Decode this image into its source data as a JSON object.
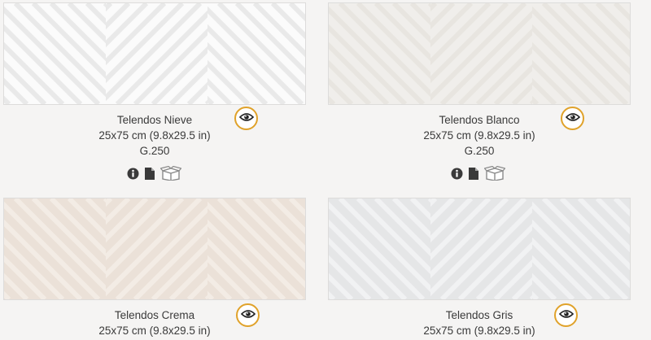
{
  "products": [
    {
      "name": "Telendos Nieve",
      "size": "25x75 cm (9.8x29.5 in)",
      "grade": "G.250",
      "tile_color": "#fbfbfb",
      "stripe_color": "#e9e9e9"
    },
    {
      "name": "Telendos Blanco",
      "size": "25x75 cm (9.8x29.5 in)",
      "grade": "G.250",
      "tile_color": "#f0eeeb",
      "stripe_color": "#e8e5e0"
    },
    {
      "name": "Telendos Crema",
      "size": "25x75 cm (9.8x29.5 in)",
      "grade": "",
      "tile_color": "#ebe1d8",
      "stripe_color": "#f3ece5"
    },
    {
      "name": "Telendos Gris",
      "size": "25x75 cm (9.8x29.5 in)",
      "grade": "",
      "tile_color": "#e5e6e7",
      "stripe_color": "#f1f2f3"
    }
  ],
  "icons": {
    "view": "eye-icon",
    "info": "info-icon",
    "datasheet": "document-icon",
    "packaging": "box-icon"
  },
  "colors": {
    "accent": "#e0a22a",
    "icon_dark": "#3a3a3a",
    "box_gray": "#8a8a8a",
    "page_bg": "#f5f4f3"
  }
}
